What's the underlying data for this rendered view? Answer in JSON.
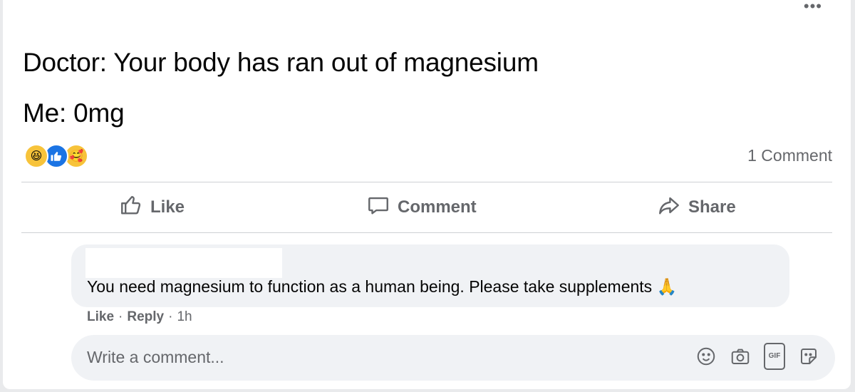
{
  "post": {
    "lines": [
      "Doctor: Your body has ran out of magnesium",
      "Me: 0mg"
    ],
    "more_icon": "more-horizontal-icon",
    "reactions": [
      "haha-reaction-icon",
      "like-reaction-icon",
      "care-reaction-icon"
    ],
    "comment_count": "1 Comment"
  },
  "actions": {
    "like": "Like",
    "comment": "Comment",
    "share": "Share"
  },
  "comment": {
    "text": "You need magnesium to function as a human being. Please take supplements",
    "emoji": "🙏",
    "like": "Like",
    "reply": "Reply",
    "time": "1h",
    "sep": "·"
  },
  "composer": {
    "placeholder": "Write a comment...",
    "icons": [
      "emoji-icon",
      "camera-icon",
      "gif-icon",
      "sticker-icon"
    ],
    "gif_label": "GIF"
  },
  "colors": {
    "like_blue": "#1b74e4",
    "secondary_text": "#65676b",
    "bubble_bg": "#f0f2f5"
  }
}
